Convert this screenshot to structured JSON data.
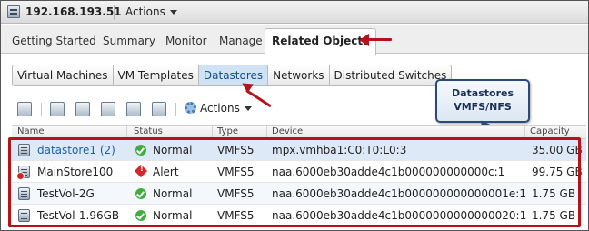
{
  "header": {
    "host": "192.168.193.51",
    "actions_label": "Actions"
  },
  "tabs": [
    "Getting Started",
    "Summary",
    "Monitor",
    "Manage",
    "Related Objects"
  ],
  "active_tab": "Related Objects",
  "subtabs": [
    "Virtual Machines",
    "VM Templates",
    "Datastores",
    "Networks",
    "Distributed Switches"
  ],
  "active_subtab": "Datastores",
  "callout": {
    "line1": "Datastores",
    "line2": "VMFS/NFS"
  },
  "toolbar": {
    "actions_label": "Actions",
    "icons": [
      "datastore-add-icon",
      "cluster-icon",
      "search-datastore-icon",
      "datastore-settings-icon",
      "datastore-copy-icon",
      "upload-icon"
    ]
  },
  "table": {
    "columns": [
      "Name",
      "Status",
      "Type",
      "Device",
      "Capacity"
    ],
    "rows": [
      {
        "name": "datastore1 (2)",
        "status": "Normal",
        "type": "VMFS5",
        "device": "mpx.vmhba1:C0:T0:L0:3",
        "capacity": "35.00 GB"
      },
      {
        "name": "MainStore100",
        "status": "Alert",
        "type": "VMFS5",
        "device": "naa.6000eb30adde4c1b000000000000c:1",
        "capacity": "99.75 GB"
      },
      {
        "name": "TestVol-2G",
        "status": "Normal",
        "type": "VMFS5",
        "device": "naa.6000eb30adde4c1b000000000000001e:1",
        "capacity": "1.75 GB"
      },
      {
        "name": "TestVol-1.96GB",
        "status": "Normal",
        "type": "VMFS5",
        "device": "naa.6000eb30adde4c1b0000000000000020:1",
        "capacity": "1.75 GB"
      }
    ]
  },
  "colors": {
    "annotation_red": "#b5121b",
    "callout_border": "#2b4a79",
    "selected_row": "#dde9f7",
    "link": "#1f5fa9"
  }
}
